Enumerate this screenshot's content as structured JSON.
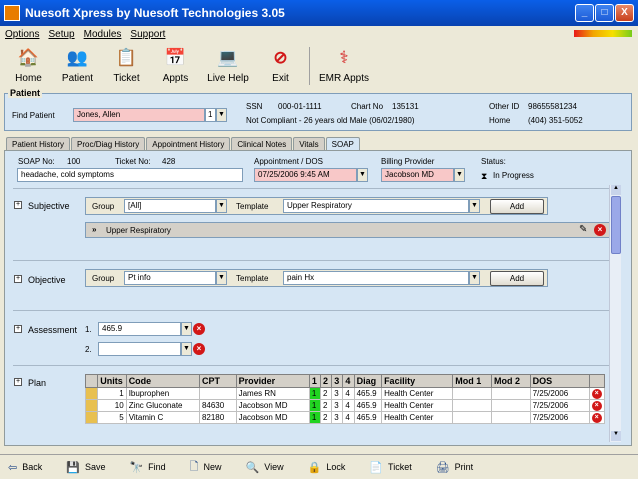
{
  "window": {
    "title": "Nuesoft Xpress by Nuesoft Technologies 3.05",
    "min": "_",
    "max": "□",
    "close": "X"
  },
  "menu": [
    "Options",
    "Setup",
    "Modules",
    "Support"
  ],
  "toolbar": [
    {
      "label": "Home",
      "icon": "home-icon",
      "glyph": "🏠"
    },
    {
      "label": "Patient",
      "icon": "patient-icon",
      "glyph": "👥"
    },
    {
      "label": "Ticket",
      "icon": "ticket-icon",
      "glyph": "📋"
    },
    {
      "label": "Appts",
      "icon": "calendar-icon",
      "glyph": "📅"
    },
    {
      "label": "Live Help",
      "icon": "live-help-icon",
      "glyph": "💻"
    },
    {
      "label": "Exit",
      "icon": "exit-icon",
      "glyph": "⊘"
    },
    {
      "label": "EMR Appts",
      "icon": "emr-appts-icon",
      "glyph": "⚕"
    }
  ],
  "patient": {
    "legend": "Patient",
    "find_label": "Find Patient",
    "name": "Jones, Allen",
    "count": "1",
    "ssn_label": "SSN",
    "ssn": "000-01-1111",
    "chart_label": "Chart No",
    "chart": "135131",
    "status_line": "Not Compliant - 26 years old Male (06/02/1980)",
    "other_id_label": "Other ID",
    "other_id": "98655581234",
    "home_label": "Home",
    "home_phone": "(404) 351-5052"
  },
  "tabs": [
    "Patient History",
    "Proc/Diag History",
    "Appointment History",
    "Clinical Notes",
    "Vitals",
    "SOAP"
  ],
  "active_tab": "SOAP",
  "soap": {
    "soap_no_label": "SOAP No:",
    "soap_no": "100",
    "ticket_no_label": "Ticket No:",
    "ticket_no": "428",
    "complaint": "headache, cold symptoms",
    "appt_label": "Appointment / DOS",
    "appt_value": "07/25/2006 9:45 AM",
    "billing_label": "Billing Provider",
    "billing_value": "Jacobson MD",
    "status_label": "Status:",
    "status_value": "In Progress"
  },
  "subjective": {
    "label": "Subjective",
    "group_label": "Group",
    "group_value": "[All]",
    "template_label": "Template",
    "template_value": "Upper Respiratory",
    "add_label": "Add",
    "item": "Upper Respiratory"
  },
  "objective": {
    "label": "Objective",
    "group_label": "Group",
    "group_value": "Pt info",
    "template_label": "Template",
    "template_value": "pain Hx",
    "add_label": "Add"
  },
  "assessment": {
    "label": "Assessment",
    "rows": [
      {
        "num": "1.",
        "value": "465.9"
      },
      {
        "num": "2.",
        "value": ""
      }
    ]
  },
  "plan": {
    "label": "Plan",
    "headers": [
      "",
      "Units",
      "Code",
      "CPT",
      "Provider",
      "1",
      "2",
      "3",
      "4",
      "Diag",
      "Facility",
      "Mod 1",
      "Mod 2",
      "DOS",
      ""
    ],
    "rows": [
      [
        "",
        "1",
        "Ibuprophen",
        "",
        "James RN",
        "1",
        "2",
        "3",
        "4",
        "465.9",
        "Health Center",
        "",
        "",
        "7/25/2006",
        ""
      ],
      [
        "",
        "10",
        "Zinc Gluconate",
        "84630",
        "Jacobson MD",
        "1",
        "2",
        "3",
        "4",
        "465.9",
        "Health Center",
        "",
        "",
        "7/25/2006",
        ""
      ],
      [
        "",
        "5",
        "Vitamin C",
        "82180",
        "Jacobson MD",
        "1",
        "2",
        "3",
        "4",
        "465.9",
        "Health Center",
        "",
        "",
        "7/25/2006",
        ""
      ]
    ]
  },
  "bottom": [
    {
      "label": "Back",
      "icon": "back-arrow-icon",
      "glyph": "⇦"
    },
    {
      "label": "Save",
      "icon": "save-icon",
      "glyph": "💾"
    },
    {
      "label": "Find",
      "icon": "binoculars-icon",
      "glyph": "🔭"
    },
    {
      "label": "New",
      "icon": "new-document-icon",
      "glyph": "🗋"
    },
    {
      "label": "View",
      "icon": "view-icon",
      "glyph": "🔍"
    },
    {
      "label": "Lock",
      "icon": "lock-icon",
      "glyph": "🔒"
    },
    {
      "label": "Ticket",
      "icon": "ticket-icon",
      "glyph": "📄"
    },
    {
      "label": "Print",
      "icon": "print-icon",
      "glyph": "🖨"
    }
  ]
}
